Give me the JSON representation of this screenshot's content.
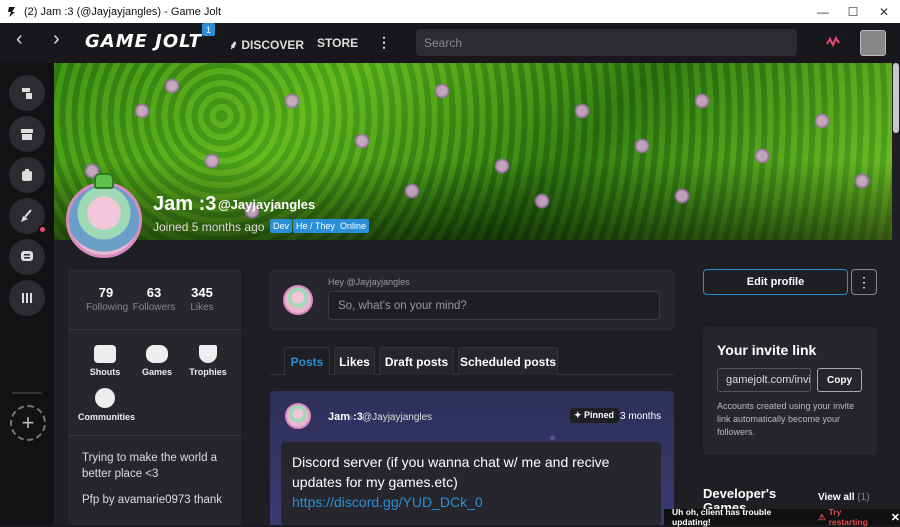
{
  "window": {
    "title": "(2) Jam :3 (@Jayjayjangles) - Game Jolt",
    "minimize": "—",
    "maximize": "☐",
    "close": "✕"
  },
  "nav": {
    "back": "‹",
    "forward": "›",
    "logo": "GAME JOLT",
    "logo_badge": "1",
    "discover": "DISCOVER",
    "store": "STORE",
    "more": "⋮",
    "search_placeholder": "Search"
  },
  "profile": {
    "name": "Jam :3",
    "handle": "@Jayjayjangles",
    "joined": "Joined 5 months ago",
    "tags": [
      "Dev",
      "He / They",
      "Online"
    ]
  },
  "stats": [
    {
      "value": "79",
      "label": "Following"
    },
    {
      "value": "63",
      "label": "Followers"
    },
    {
      "value": "345",
      "label": "Likes"
    }
  ],
  "shortcuts": [
    "Shouts",
    "Games",
    "Trophies",
    "Communities"
  ],
  "bio": {
    "line1": "Trying to make the world a better place <3",
    "line2": "Pfp by avamarie0973 thank"
  },
  "composer": {
    "hey": "Hey @Jayjayjangles",
    "placeholder": "So, what's on your mind?"
  },
  "tabs": [
    "Posts",
    "Likes",
    "Draft posts",
    "Scheduled posts"
  ],
  "post": {
    "name": "Jam :3",
    "handle": "@Jayjayjangles",
    "pinned": "Pinned",
    "time": "3 months",
    "text": "Discord server (if you wanna chat w/ me and recive updates for my games.etc)",
    "link": "https://discord.gg/YUD_DCk_0"
  },
  "right": {
    "edit_profile": "Edit profile",
    "more": "⋮",
    "invite_title": "Your invite link",
    "invite_link": "gamejolt.com/invite",
    "copy": "Copy",
    "invite_desc": "Accounts created using your invite link automatically become your followers.",
    "dev_title": "Developer's Games",
    "view_all": "View all",
    "view_all_count": "(1)"
  },
  "toast": {
    "text": "Uh oh, client has trouble updating!",
    "warn": "⚠",
    "retry": "Try restarting",
    "close": "✕"
  },
  "colors": {
    "accent": "#2a8fd6",
    "notify": "#e84a6f",
    "panel": "#26262c",
    "bg": "#1e1e23"
  }
}
